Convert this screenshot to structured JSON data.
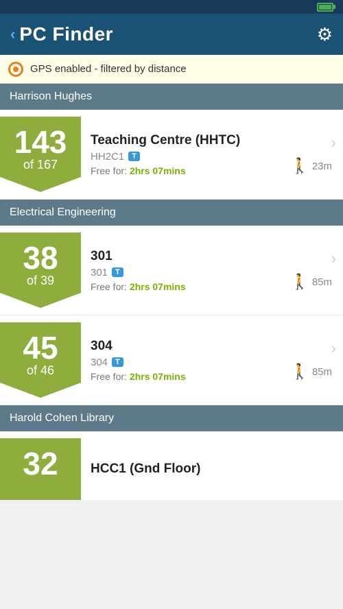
{
  "statusBar": {
    "batteryColor": "#4caf50"
  },
  "header": {
    "backLabel": "‹",
    "title": "PC Finder",
    "gearIcon": "⚙"
  },
  "gpsBar": {
    "text": "GPS enabled - filtered by distance"
  },
  "sections": [
    {
      "id": "harrison-hughes",
      "title": "Harrison Hughes",
      "cards": [
        {
          "id": "hhtc",
          "countMain": "143",
          "countSub": "of 167",
          "name": "Teaching Centre (HHTC)",
          "code": "HH2C1",
          "tag": "T",
          "freeLabel": "Free for:",
          "freeTime": "2hrs 07mins",
          "walkDist": "23m"
        }
      ]
    },
    {
      "id": "electrical-engineering",
      "title": "Electrical Engineering",
      "cards": [
        {
          "id": "301",
          "countMain": "38",
          "countSub": "of 39",
          "name": "301",
          "code": "301",
          "tag": "T",
          "freeLabel": "Free for:",
          "freeTime": "2hrs 07mins",
          "walkDist": "85m"
        },
        {
          "id": "304",
          "countMain": "45",
          "countSub": "of 46",
          "name": "304",
          "code": "304",
          "tag": "T",
          "freeLabel": "Free for:",
          "freeTime": "2hrs 07mins",
          "walkDist": "85m"
        }
      ]
    },
    {
      "id": "harold-cohen-library",
      "title": "Harold Cohen Library",
      "cards": [
        {
          "id": "hcc1",
          "countMain": "32",
          "countSub": "",
          "name": "HCC1 (Gnd Floor)",
          "code": "",
          "tag": "",
          "freeLabel": "",
          "freeTime": "",
          "walkDist": "",
          "partial": true
        }
      ]
    }
  ],
  "icons": {
    "walk": "🚶",
    "gpsOuter": "orange",
    "chevron": "›"
  }
}
